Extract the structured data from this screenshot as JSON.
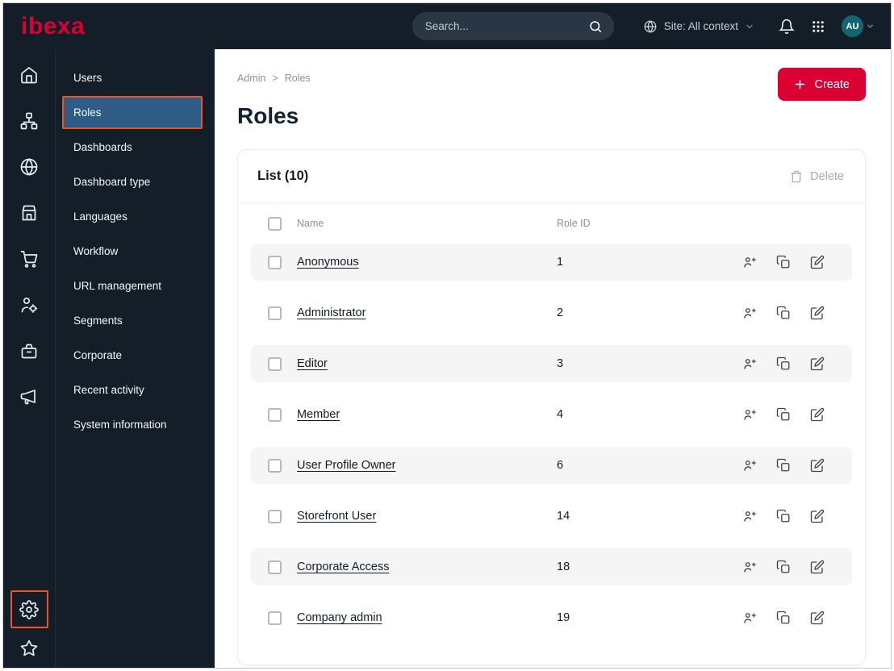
{
  "topbar": {
    "logo": "ibexa",
    "search_placeholder": "Search...",
    "site_selector": "Site: All context",
    "avatar_initials": "AU"
  },
  "rail": {
    "items": [
      "home",
      "content-structure",
      "site",
      "storefront",
      "commerce",
      "customers",
      "orders",
      "marketing"
    ],
    "bottom_items": [
      "admin-settings",
      "bookmarks"
    ]
  },
  "menu": {
    "items": [
      {
        "label": "Users",
        "active": false
      },
      {
        "label": "Roles",
        "active": true
      },
      {
        "label": "Dashboards",
        "active": false
      },
      {
        "label": "Dashboard type",
        "active": false
      },
      {
        "label": "Languages",
        "active": false
      },
      {
        "label": "Workflow",
        "active": false
      },
      {
        "label": "URL management",
        "active": false
      },
      {
        "label": "Segments",
        "active": false
      },
      {
        "label": "Corporate",
        "active": false
      },
      {
        "label": "Recent activity",
        "active": false
      },
      {
        "label": "System information",
        "active": false
      }
    ]
  },
  "main": {
    "breadcrumb": {
      "items": [
        "Admin",
        "Roles"
      ],
      "separator": ">"
    },
    "create_label": "Create",
    "page_title": "Roles"
  },
  "list": {
    "title": "List (10)",
    "delete_label": "Delete",
    "columns": [
      "Name",
      "Role ID"
    ],
    "rows": [
      {
        "name": "Anonymous",
        "role_id": "1"
      },
      {
        "name": "Administrator",
        "role_id": "2"
      },
      {
        "name": "Editor",
        "role_id": "3"
      },
      {
        "name": "Member",
        "role_id": "4"
      },
      {
        "name": "User Profile Owner",
        "role_id": "6"
      },
      {
        "name": "Storefront User",
        "role_id": "14"
      },
      {
        "name": "Corporate Access",
        "role_id": "18"
      },
      {
        "name": "Company admin",
        "role_id": "19"
      }
    ]
  },
  "colors": {
    "topbar_bg": "#141e29",
    "brand_red": "#db0032",
    "highlight_orange": "#ee5323",
    "selected_blue": "#2e5c87",
    "avatar_teal": "#116672",
    "row_stripe": "#f5f5f5"
  }
}
